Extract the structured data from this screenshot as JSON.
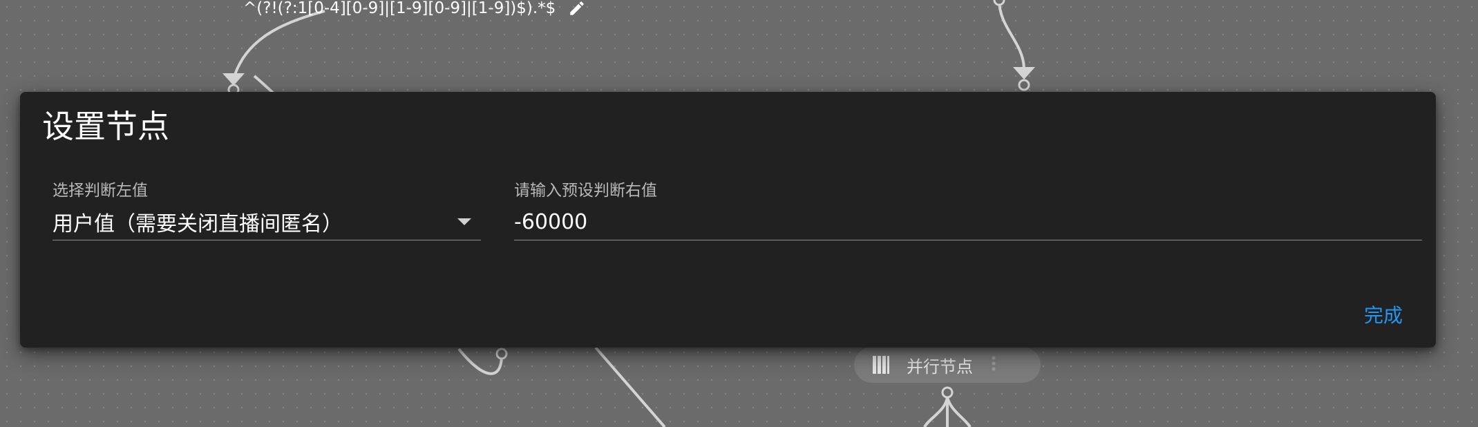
{
  "canvas": {
    "edge_condition_label": "^(?!(?:1[0-4][0-9]|[1-9][0-9]|[1-9])$).*$",
    "edit_icon": "pencil-icon",
    "parallel_node": {
      "label": "并行节点",
      "icon": "parallel-bars-icon",
      "menu_icon": "more-vertical-icon"
    }
  },
  "dialog": {
    "title": "设置节点",
    "left_field": {
      "label": "选择判断左值",
      "value": "用户值（需要关闭直播间匿名）",
      "icon": "dropdown-arrow-icon"
    },
    "right_field": {
      "label": "请输入预设判断右值",
      "value": "-60000"
    },
    "done_label": "完成"
  },
  "colors": {
    "canvas_bg": "#6b6b6b",
    "dialog_bg": "#212121",
    "accent": "#2196f3",
    "wire": "#d4d4d4"
  }
}
